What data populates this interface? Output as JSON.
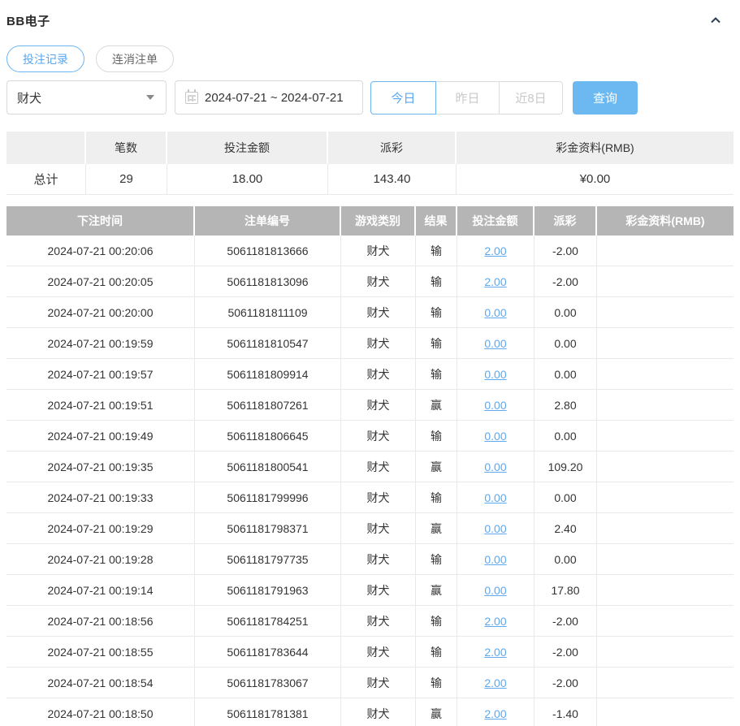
{
  "header": {
    "title": "BB电子",
    "collapse_icon": "chevron-up-icon"
  },
  "tabs": [
    {
      "label": "投注记录",
      "active": true
    },
    {
      "label": "连消注单",
      "active": false
    }
  ],
  "filters": {
    "game_select": {
      "value": "财犬",
      "icon": "caret-down-icon"
    },
    "date_range": {
      "value": "2024-07-21 ~ 2024-07-21",
      "icon": "calendar-icon"
    },
    "quick_ranges": [
      {
        "label": "今日",
        "active": true
      },
      {
        "label": "昨日",
        "active": false
      },
      {
        "label": "近8日",
        "active": false
      }
    ],
    "query_label": "查询"
  },
  "summary": {
    "columns": [
      "",
      "笔数",
      "投注金额",
      "派彩",
      "彩金资料(RMB)"
    ],
    "total_label": "总计",
    "count": "29",
    "bet_amount": "18.00",
    "payout": "143.40",
    "bonus": "¥0.00"
  },
  "records_table": {
    "columns": [
      "下注时间",
      "注单编号",
      "游戏类别",
      "结果",
      "投注金额",
      "派彩",
      "彩金资料(RMB)"
    ],
    "rows": [
      {
        "time": "2024-07-21 00:20:06",
        "order_id": "5061181813666",
        "game": "财犬",
        "result": "输",
        "bet": "2.00",
        "payout": "-2.00",
        "bonus": ""
      },
      {
        "time": "2024-07-21 00:20:05",
        "order_id": "5061181813096",
        "game": "财犬",
        "result": "输",
        "bet": "2.00",
        "payout": "-2.00",
        "bonus": ""
      },
      {
        "time": "2024-07-21 00:20:00",
        "order_id": "5061181811109",
        "game": "财犬",
        "result": "输",
        "bet": "0.00",
        "payout": "0.00",
        "bonus": ""
      },
      {
        "time": "2024-07-21 00:19:59",
        "order_id": "5061181810547",
        "game": "财犬",
        "result": "输",
        "bet": "0.00",
        "payout": "0.00",
        "bonus": ""
      },
      {
        "time": "2024-07-21 00:19:57",
        "order_id": "5061181809914",
        "game": "财犬",
        "result": "输",
        "bet": "0.00",
        "payout": "0.00",
        "bonus": ""
      },
      {
        "time": "2024-07-21 00:19:51",
        "order_id": "5061181807261",
        "game": "财犬",
        "result": "赢",
        "bet": "0.00",
        "payout": "2.80",
        "bonus": ""
      },
      {
        "time": "2024-07-21 00:19:49",
        "order_id": "5061181806645",
        "game": "财犬",
        "result": "输",
        "bet": "0.00",
        "payout": "0.00",
        "bonus": ""
      },
      {
        "time": "2024-07-21 00:19:35",
        "order_id": "5061181800541",
        "game": "财犬",
        "result": "赢",
        "bet": "0.00",
        "payout": "109.20",
        "bonus": ""
      },
      {
        "time": "2024-07-21 00:19:33",
        "order_id": "5061181799996",
        "game": "财犬",
        "result": "输",
        "bet": "0.00",
        "payout": "0.00",
        "bonus": ""
      },
      {
        "time": "2024-07-21 00:19:29",
        "order_id": "5061181798371",
        "game": "财犬",
        "result": "赢",
        "bet": "0.00",
        "payout": "2.40",
        "bonus": ""
      },
      {
        "time": "2024-07-21 00:19:28",
        "order_id": "5061181797735",
        "game": "财犬",
        "result": "输",
        "bet": "0.00",
        "payout": "0.00",
        "bonus": ""
      },
      {
        "time": "2024-07-21 00:19:14",
        "order_id": "5061181791963",
        "game": "财犬",
        "result": "赢",
        "bet": "0.00",
        "payout": "17.80",
        "bonus": ""
      },
      {
        "time": "2024-07-21 00:18:56",
        "order_id": "5061181784251",
        "game": "财犬",
        "result": "输",
        "bet": "2.00",
        "payout": "-2.00",
        "bonus": ""
      },
      {
        "time": "2024-07-21 00:18:55",
        "order_id": "5061181783644",
        "game": "财犬",
        "result": "输",
        "bet": "2.00",
        "payout": "-2.00",
        "bonus": ""
      },
      {
        "time": "2024-07-21 00:18:54",
        "order_id": "5061181783067",
        "game": "财犬",
        "result": "输",
        "bet": "2.00",
        "payout": "-2.00",
        "bonus": ""
      },
      {
        "time": "2024-07-21 00:18:50",
        "order_id": "5061181781381",
        "game": "财犬",
        "result": "赢",
        "bet": "2.00",
        "payout": "-1.40",
        "bonus": ""
      }
    ]
  },
  "colors": {
    "primary_blue": "#5ba7ec",
    "button_blue": "#6cb8f0",
    "negative_red": "#e96b6b",
    "table_header_gray": "#b5b5b5",
    "summary_header_gray": "#efefef",
    "border_gray": "#e9e9e9",
    "text_dark": "#333333"
  }
}
